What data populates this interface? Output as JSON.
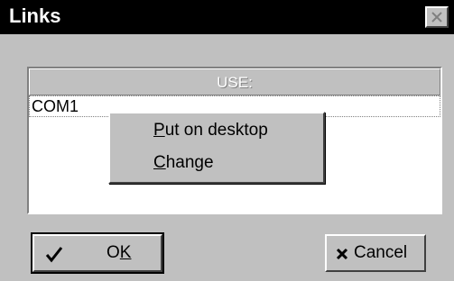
{
  "window": {
    "title": "Links",
    "close_icon": "close-icon"
  },
  "list": {
    "column_header": "USE:",
    "rows": [
      "COM1"
    ]
  },
  "context_menu": {
    "items": [
      {
        "accel": "P",
        "rest": "ut on desktop"
      },
      {
        "accel": "C",
        "rest": "hange"
      }
    ]
  },
  "buttons": {
    "ok": {
      "pre": "O",
      "accel": "K",
      "icon": "check-icon"
    },
    "cancel": {
      "label": "Cancel",
      "icon": "x-icon"
    }
  }
}
